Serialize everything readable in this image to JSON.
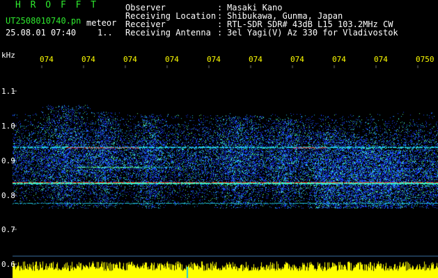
{
  "header": {
    "logo": "H R O F F T",
    "filename": "UT2508010740.pn",
    "tag": "meteor",
    "datetime": "25.08.01 07:40",
    "counter": "1..",
    "fields": [
      {
        "label": "Observer",
        "value": "Masaki Kano"
      },
      {
        "label": "Receiving Location",
        "value": "Shibukawa, Gunma, Japan"
      },
      {
        "label": "Receiver",
        "value": "RTL-SDR SDR# 43dB L15 103.2MHz CW"
      },
      {
        "label": "Receiving Antenna",
        "value": "3el Yagi(V) Az 330 for Vladivostok"
      }
    ],
    "separator": ":"
  },
  "axis": {
    "unit": "kHz",
    "x_ticks": [
      "074",
      "074",
      "074",
      "074",
      "074",
      "074",
      "074",
      "074",
      "074",
      "0750"
    ],
    "y_ticks": [
      "1.1",
      "1.0",
      "0.9",
      "0.8",
      "0.7",
      "0.6"
    ]
  },
  "colors": {
    "background": "#000000",
    "header_green": "#2ee82e",
    "header_white": "#ffffff",
    "axis_yellow": "#ffff00",
    "gridline": "#3a6fa0",
    "strong_signal": "#ff2020",
    "noise_blue": "#1a3cff",
    "noise_cyan": "#20e0e0",
    "amplitude_bar": "#ffff00"
  }
}
